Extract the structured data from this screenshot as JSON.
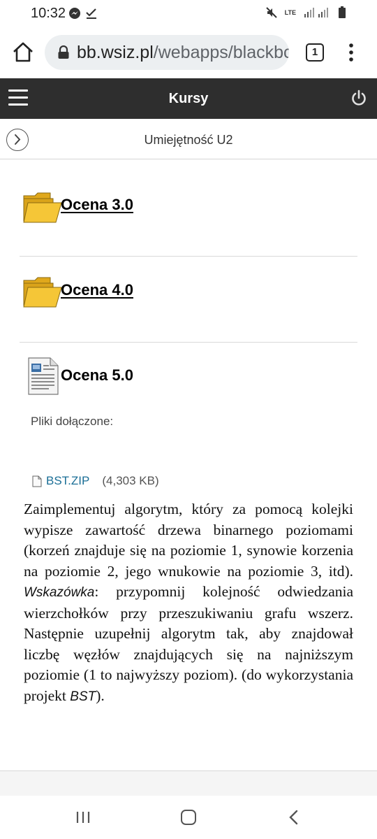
{
  "status_bar": {
    "time": "10:32",
    "network": "LTE",
    "icons": [
      "messenger-icon",
      "check-icon",
      "mute-icon",
      "signal-icon",
      "battery-icon"
    ]
  },
  "browser": {
    "url_host": "bb.wsiz.pl",
    "url_path": "/webapps/blackbc",
    "tab_count": "1"
  },
  "header": {
    "title": "Kursy",
    "background": "#2e2e2e"
  },
  "subheader": {
    "title": "Umiejętność U2"
  },
  "items": [
    {
      "title": "Ocena 3.0",
      "type": "folder",
      "link": true
    },
    {
      "title": "Ocena 4.0",
      "type": "folder",
      "link": true
    },
    {
      "title": "Ocena 5.0",
      "type": "document",
      "link": false
    }
  ],
  "attachments": {
    "label": "Pliki dołączone:",
    "file_name": "BST.ZIP",
    "file_size": "(4,303 KB)"
  },
  "description": {
    "part1": "Zaimplementuj algorytm, który za pomocą kolejki wypisze zawartość drzewa binarnego poziomami (korzeń znajduje się na poziomie 1, synowie korzenia na poziomie 2, jego wnukowie na poziomie 3, itd). ",
    "hint_word": "Wskazówka",
    "part2": ": przypomnij kolejność odwiedzania wierzchołków przy przeszukiwaniu grafu wszerz. Następnie uzupełnij algorytm tak, aby znajdował liczbę węzłów znajdujących się na najniższym poziomie (1 to najwyższy poziom). (do wykorzystania projekt ",
    "project_word": "BST",
    "part3": ")."
  },
  "colors": {
    "link": "#1a6e96",
    "folder": "#f2c12e"
  }
}
